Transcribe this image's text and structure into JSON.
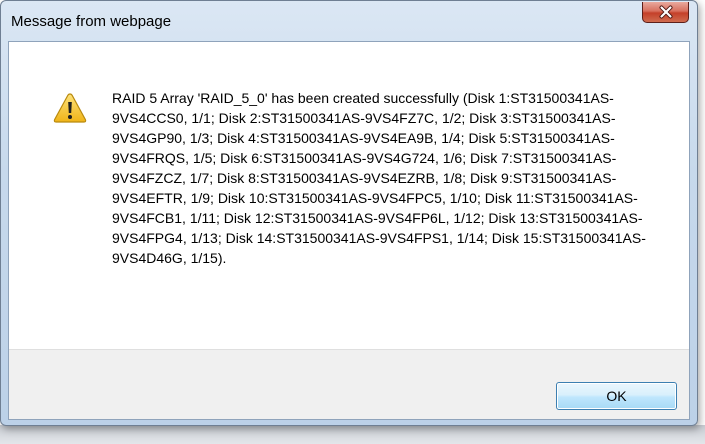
{
  "dialog": {
    "title": "Message from webpage",
    "message": "RAID 5 Array 'RAID_5_0' has been created successfully (Disk 1:ST31500341AS-9VS4CCS0, 1/1; Disk 2:ST31500341AS-9VS4FZ7C, 1/2; Disk 3:ST31500341AS-9VS4GP90, 1/3; Disk 4:ST31500341AS-9VS4EA9B, 1/4; Disk 5:ST31500341AS-9VS4FRQS, 1/5; Disk 6:ST31500341AS-9VS4G724, 1/6; Disk 7:ST31500341AS-9VS4FZCZ, 1/7; Disk 8:ST31500341AS-9VS4EZRB, 1/8; Disk 9:ST31500341AS-9VS4EFTR, 1/9; Disk 10:ST31500341AS-9VS4FPC5, 1/10; Disk 11:ST31500341AS-9VS4FCB1, 1/11; Disk 12:ST31500341AS-9VS4FP6L, 1/12; Disk 13:ST31500341AS-9VS4FPG4, 1/13; Disk 14:ST31500341AS-9VS4FPS1, 1/14; Disk 15:ST31500341AS-9VS4D46G, 1/15).",
    "ok_label": "OK",
    "icon": "warning-icon",
    "close_icon": "close-icon"
  },
  "colors": {
    "title_bar": "#c7d9ec",
    "close_button": "#c4402a",
    "footer": "#f0f0f0",
    "ok_button_border": "#3c7fb1",
    "warning_fill": "#f5c52a"
  }
}
